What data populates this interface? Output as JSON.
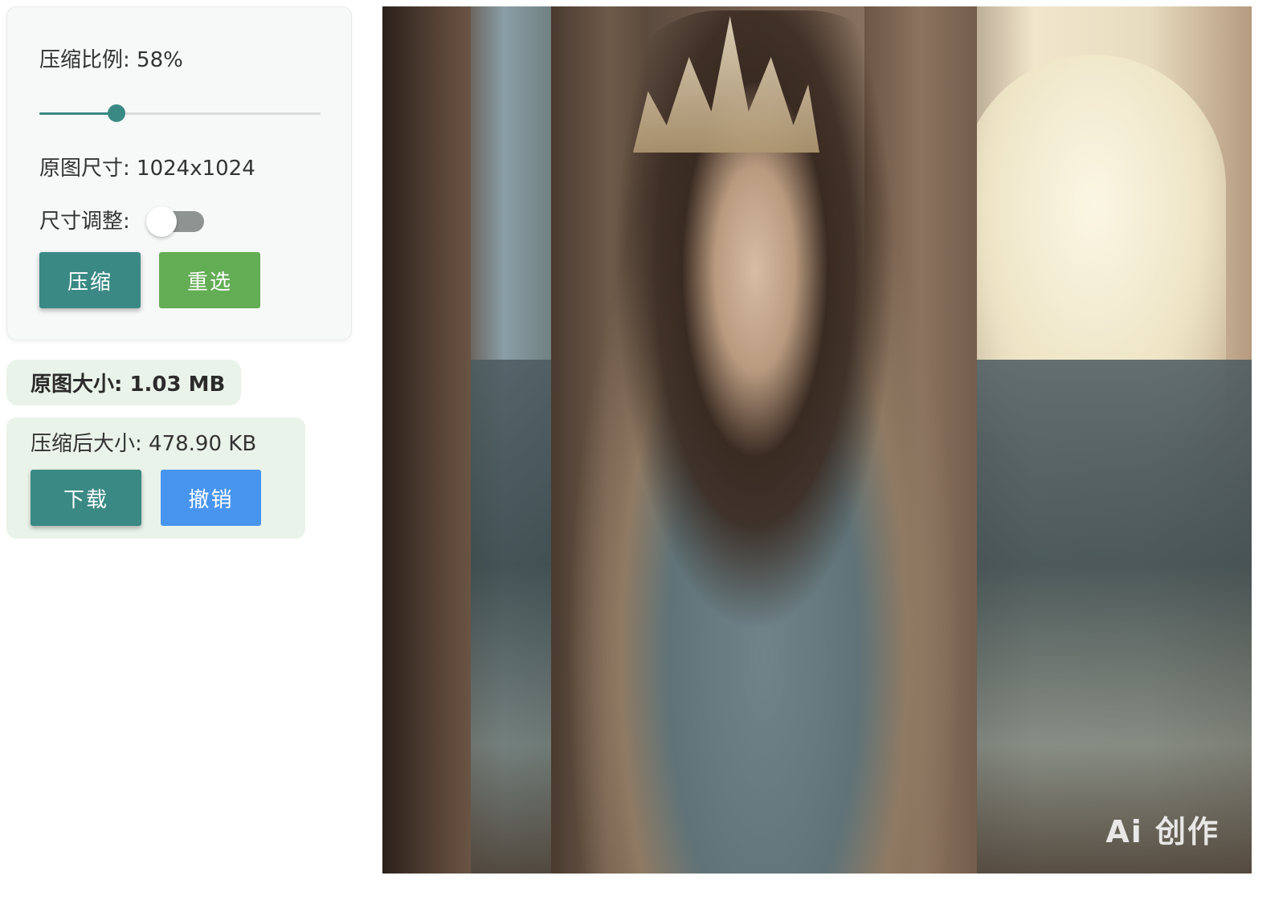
{
  "settings": {
    "ratio_label": "压缩比例: 58%",
    "ratio_value": 58,
    "original_dimensions_label": "原图尺寸: 1024x1024",
    "resize_label": "尺寸调整:",
    "resize_enabled": false,
    "compress_button": "压缩",
    "reselect_button": "重选"
  },
  "results": {
    "original_size_label": "原图大小: 1.03 MB",
    "compressed_size_label": "压缩后大小: 478.90 KB",
    "download_button": "下载",
    "undo_button": "撤销"
  },
  "preview": {
    "watermark": "Ai 创作"
  },
  "colors": {
    "primary": "#3b8984",
    "reselect": "#63ad55",
    "undo": "#4895ef",
    "result_bg": "#eaf3ea"
  }
}
